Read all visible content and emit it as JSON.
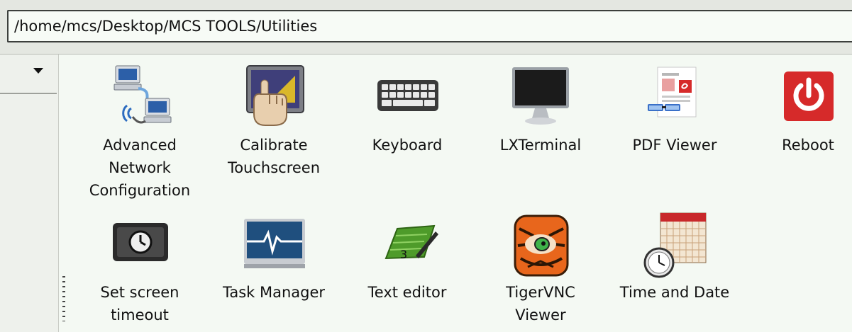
{
  "path_bar": {
    "value": "/home/mcs/Desktop/MCS TOOLS/Utilities"
  },
  "items": [
    {
      "label": "Advanced\nNetwork\nConfiguration",
      "icon": "network-computers-icon"
    },
    {
      "label": "Calibrate\nTouchscreen",
      "icon": "touchscreen-hand-icon"
    },
    {
      "label": "Keyboard",
      "icon": "keyboard-icon"
    },
    {
      "label": "LXTerminal",
      "icon": "monitor-icon"
    },
    {
      "label": "PDF Viewer",
      "icon": "pdf-document-icon"
    },
    {
      "label": "Reboot",
      "icon": "power-icon"
    },
    {
      "label": "Set screen\ntimeout",
      "icon": "timer-icon"
    },
    {
      "label": "Task Manager",
      "icon": "heartbeat-monitor-icon"
    },
    {
      "label": "Text editor",
      "icon": "pen-paper-icon"
    },
    {
      "label": "TigerVNC\nViewer",
      "icon": "tiger-icon"
    },
    {
      "label": "Time and Date",
      "icon": "calendar-clock-icon"
    }
  ],
  "colors": {
    "reboot_red": "#d62a2a",
    "terminal_black": "#1b1b1b",
    "text_editor_green": "#4e9b2a",
    "tiger_orange": "#e8661c",
    "calendar_red": "#c8282a"
  }
}
